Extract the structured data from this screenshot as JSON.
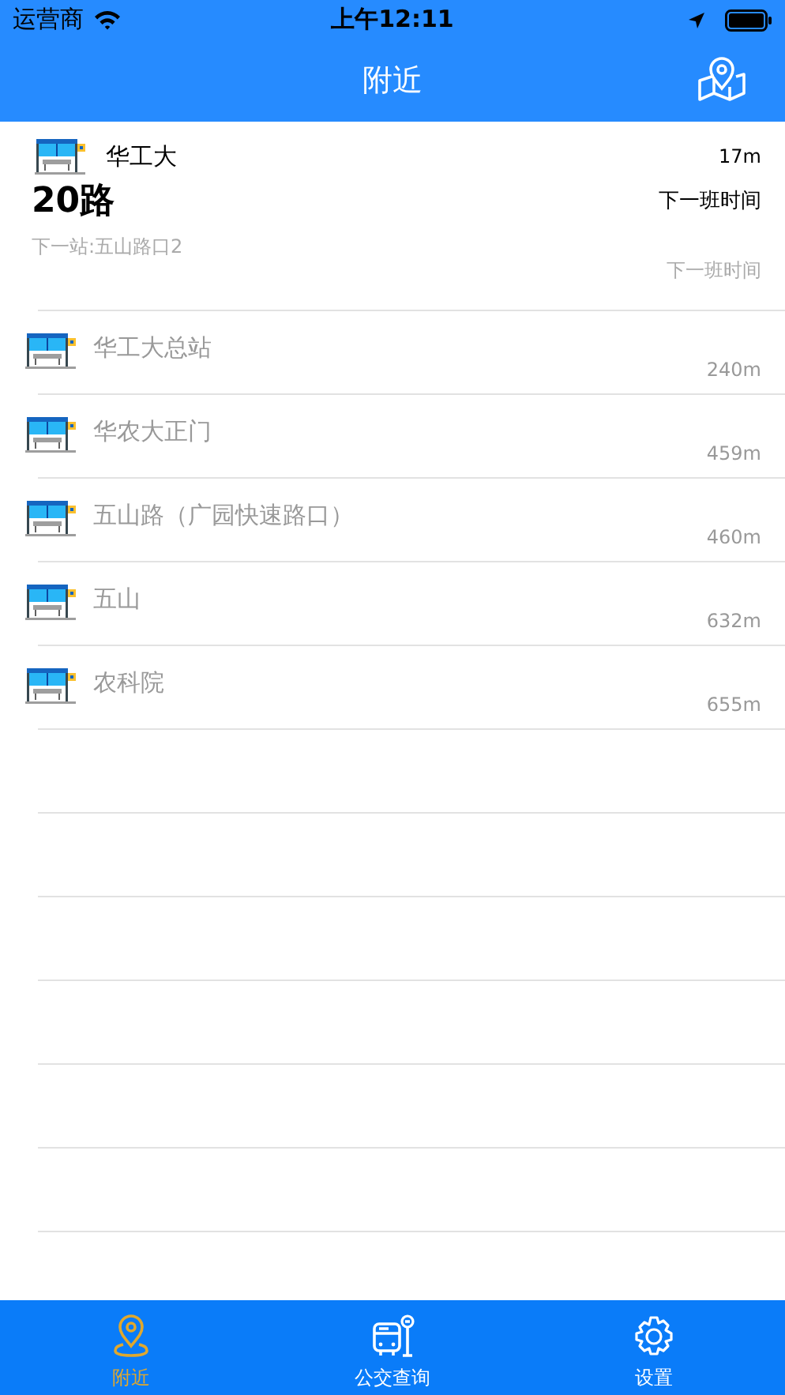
{
  "status_bar": {
    "carrier": "运营商",
    "time": "上午12:11"
  },
  "nav_bar": {
    "title": "附近"
  },
  "nearest": {
    "stop": "华工大",
    "distance": "17m",
    "route": "20路",
    "next_time_label": "下一班时间",
    "next_stop": "下一站:五山路口2",
    "next_time_value": "下一班时间"
  },
  "stops": [
    {
      "name": "华工大总站",
      "distance": "240m"
    },
    {
      "name": "华农大正门",
      "distance": "459m"
    },
    {
      "name": "五山路（广园快速路口）",
      "distance": "460m"
    },
    {
      "name": "五山",
      "distance": "632m"
    },
    {
      "name": "农科院",
      "distance": "655m"
    }
  ],
  "tabs": [
    {
      "label": "附近",
      "kind": "nearby",
      "selected": true
    },
    {
      "label": "公交查询",
      "kind": "bus",
      "selected": false
    },
    {
      "label": "设置",
      "kind": "settings",
      "selected": false
    }
  ]
}
